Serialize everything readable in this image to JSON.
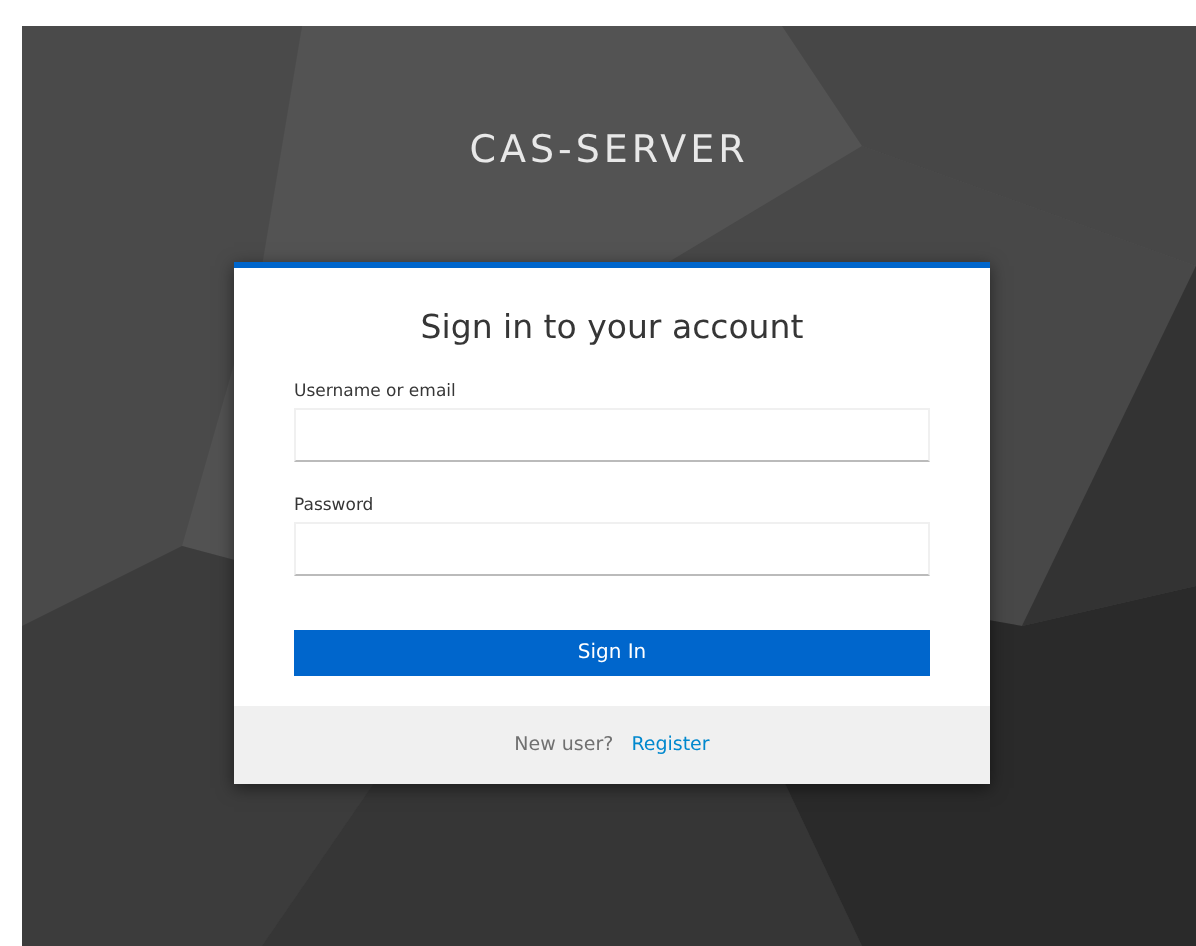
{
  "header": {
    "title": "CAS-SERVER"
  },
  "login": {
    "title": "Sign in to your account",
    "fields": [
      {
        "label": "Username or email"
      },
      {
        "label": "Password"
      }
    ],
    "submit": "Sign In",
    "footer": {
      "text": "New user?",
      "link": "Register"
    }
  }
}
